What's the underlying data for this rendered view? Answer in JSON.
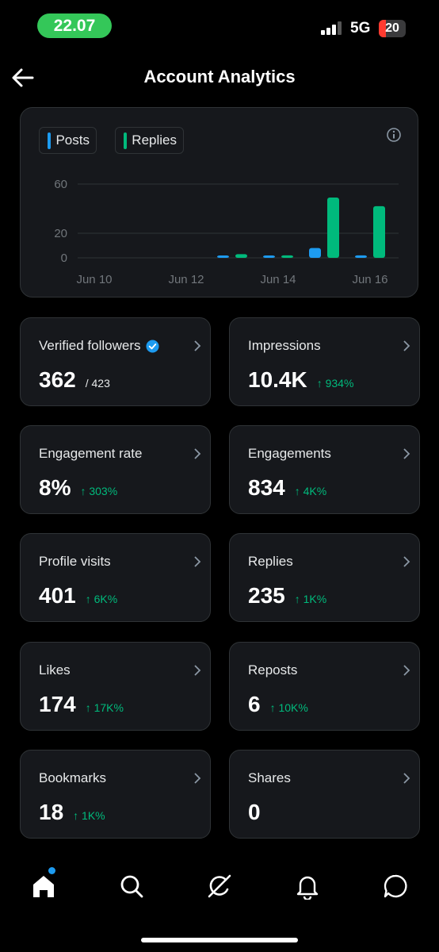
{
  "status_bar": {
    "time": "22.07",
    "network": "5G",
    "battery": "20"
  },
  "header": {
    "title": "Account Analytics"
  },
  "chart": {
    "legend": [
      {
        "label": "Posts",
        "color": "#1d9bf0"
      },
      {
        "label": "Replies",
        "color": "#00ba7c"
      }
    ]
  },
  "chart_data": {
    "type": "bar",
    "y_ticks": [
      "60",
      "20",
      "0"
    ],
    "x_ticks": [
      "Jun 10",
      "Jun 12",
      "Jun 14",
      "Jun 16"
    ],
    "ylim": [
      0,
      60
    ],
    "categories": [
      "Jun 13",
      "Jun 14",
      "Jun 15",
      "Jun 16"
    ],
    "series": [
      {
        "name": "Posts",
        "color": "#1d9bf0",
        "values": [
          1,
          1,
          8,
          2
        ]
      },
      {
        "name": "Replies",
        "color": "#00ba7c",
        "values": [
          3,
          2,
          49,
          42
        ]
      }
    ],
    "grid": true
  },
  "stats": [
    {
      "label": "Verified followers",
      "value": "362",
      "total": "/ 423",
      "verified": true
    },
    {
      "label": "Impressions",
      "value": "10.4K",
      "change": "↑ 934%"
    },
    {
      "label": "Engagement rate",
      "value": "8%",
      "change": "↑ 303%"
    },
    {
      "label": "Engagements",
      "value": "834",
      "change": "↑ 4K%"
    },
    {
      "label": "Profile visits",
      "value": "401",
      "change": "↑ 6K%"
    },
    {
      "label": "Replies",
      "value": "235",
      "change": "↑ 1K%"
    },
    {
      "label": "Likes",
      "value": "174",
      "change": "↑ 17K%"
    },
    {
      "label": "Reposts",
      "value": "6",
      "change": "↑ 10K%"
    },
    {
      "label": "Bookmarks",
      "value": "18",
      "change": "↑ 1K%"
    },
    {
      "label": "Shares",
      "value": "0"
    }
  ],
  "nav": [
    {
      "icon": "home-icon",
      "active": true
    },
    {
      "icon": "search-icon"
    },
    {
      "icon": "grok-icon"
    },
    {
      "icon": "bell-icon"
    },
    {
      "icon": "messages-icon"
    }
  ]
}
